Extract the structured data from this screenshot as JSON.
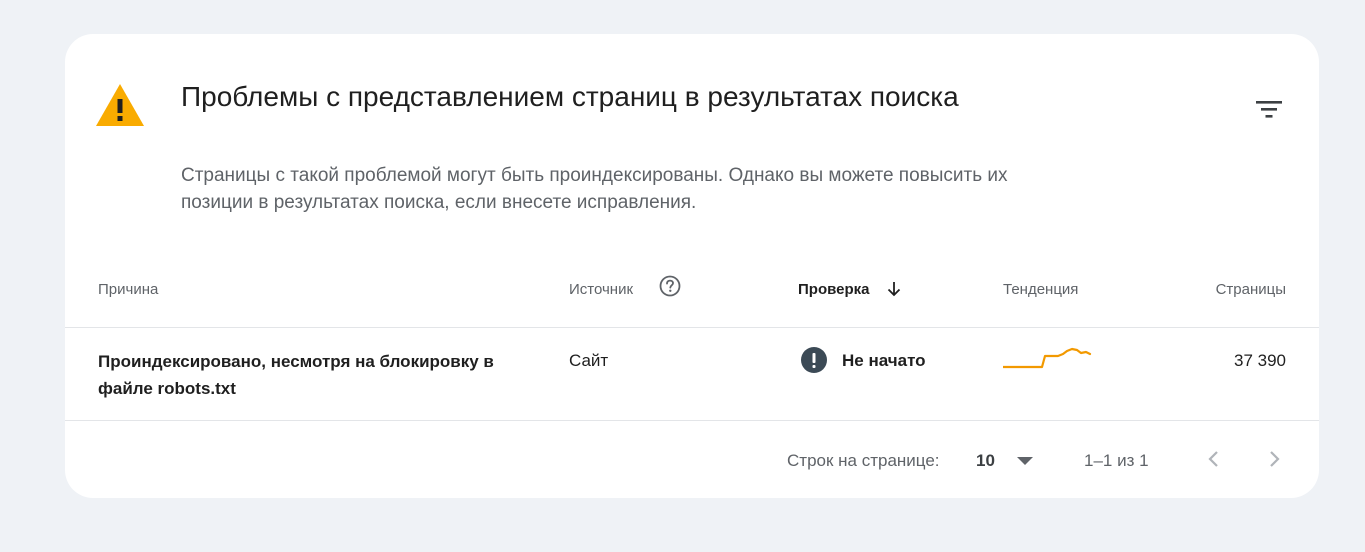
{
  "card": {
    "title": "Проблемы с представлением страниц в результатах поиска",
    "subtitle": "Страницы с такой проблемой могут быть проиндексированы. Однако вы можете повысить их позиции в результатах поиска, если внесете исправления.",
    "warning_icon": "warning-triangle-icon",
    "filter_icon": "filter-icon"
  },
  "table": {
    "headers": {
      "reason": "Причина",
      "source": "Источник",
      "validation": "Проверка",
      "trend": "Тенденция",
      "pages": "Страницы"
    },
    "sorted_column": "validation",
    "rows": [
      {
        "reason": "Проиндексировано, несмотря на блокировку в файле robots.txt",
        "source": "Сайт",
        "status": "Не начато",
        "status_icon": "exclamation-circle-icon",
        "pages": "37 390",
        "trend_color": "#f29900"
      }
    ]
  },
  "pagination": {
    "rows_per_page_label": "Строк на странице:",
    "rows_per_page": "10",
    "range": "1–1 из 1"
  },
  "colors": {
    "warning": "#f9ab00",
    "status_icon": "#3c4a56",
    "trend": "#f29900",
    "background": "#eff2f6"
  }
}
